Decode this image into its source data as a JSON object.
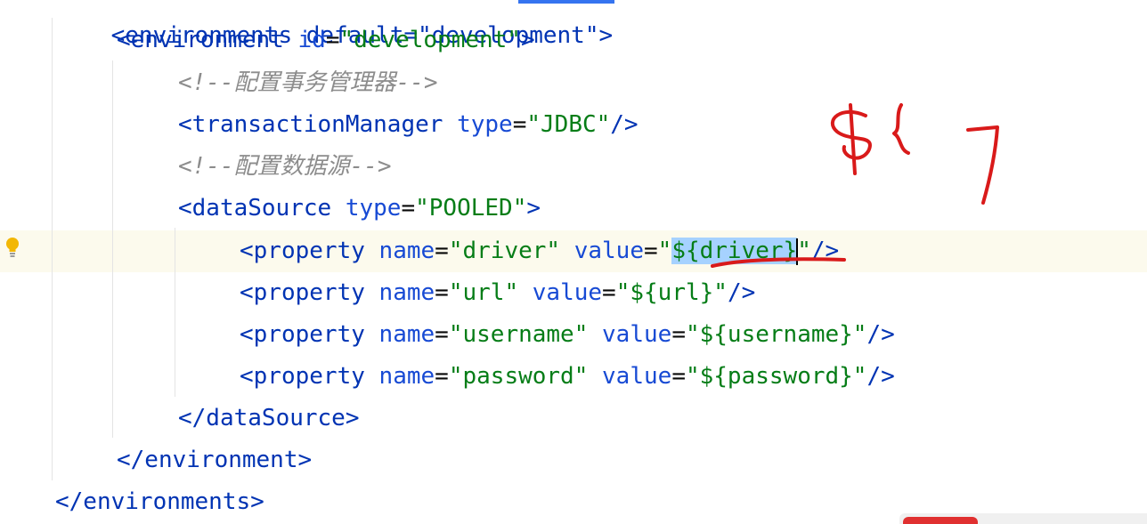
{
  "editor": {
    "cutoff_line": "<environments default=\"development\">",
    "lines": {
      "env_open": {
        "open": "<environment",
        "attr": "id",
        "eq": "=",
        "value": "\"development\"",
        "close": ">"
      },
      "comment1": {
        "text": "<!--配置事务管理器-->"
      },
      "tx": {
        "open": "<transactionManager",
        "attr": "type",
        "eq": "=",
        "value": "\"JDBC\"",
        "close": "/>"
      },
      "comment2": {
        "text": "<!--配置数据源-->"
      },
      "ds_open": {
        "open": "<dataSource",
        "attr": "type",
        "eq": "=",
        "value": "\"POOLED\"",
        "close": ">"
      },
      "prop_driver": {
        "open": "<property",
        "name_attr": "name",
        "eq": "=",
        "name_val": "\"driver\"",
        "value_attr": "value",
        "q1": "\"",
        "value_val": "${driver}",
        "q2": "\"",
        "close": "/>"
      },
      "prop_url": {
        "open": "<property",
        "name_attr": "name",
        "eq": "=",
        "name_val": "\"url\"",
        "value_attr": "value",
        "value_val": "\"${url}\"",
        "close": "/>"
      },
      "prop_username": {
        "open": "<property",
        "name_attr": "name",
        "eq": "=",
        "name_val": "\"username\"",
        "value_attr": "value",
        "value_val": "\"${username}\"",
        "close": "/>"
      },
      "prop_password": {
        "open": "<property",
        "name_attr": "name",
        "eq": "=",
        "name_val": "\"password\"",
        "value_attr": "value",
        "value_val": "\"${password}\"",
        "close": "/>"
      },
      "ds_close": {
        "text": "</dataSource>"
      },
      "env_close": {
        "text": "</environment>"
      },
      "envs_close": {
        "text": "</environments>"
      }
    },
    "gutter_icon": "lightbulb-icon",
    "colors": {
      "tag": "#0033b3",
      "attribute": "#174ad4",
      "string": "#067d17",
      "comment": "#8c8c8c",
      "selection": "#a6d2ff",
      "current_line": "#fcfaed",
      "annotation_ink": "#d91a1a"
    }
  }
}
